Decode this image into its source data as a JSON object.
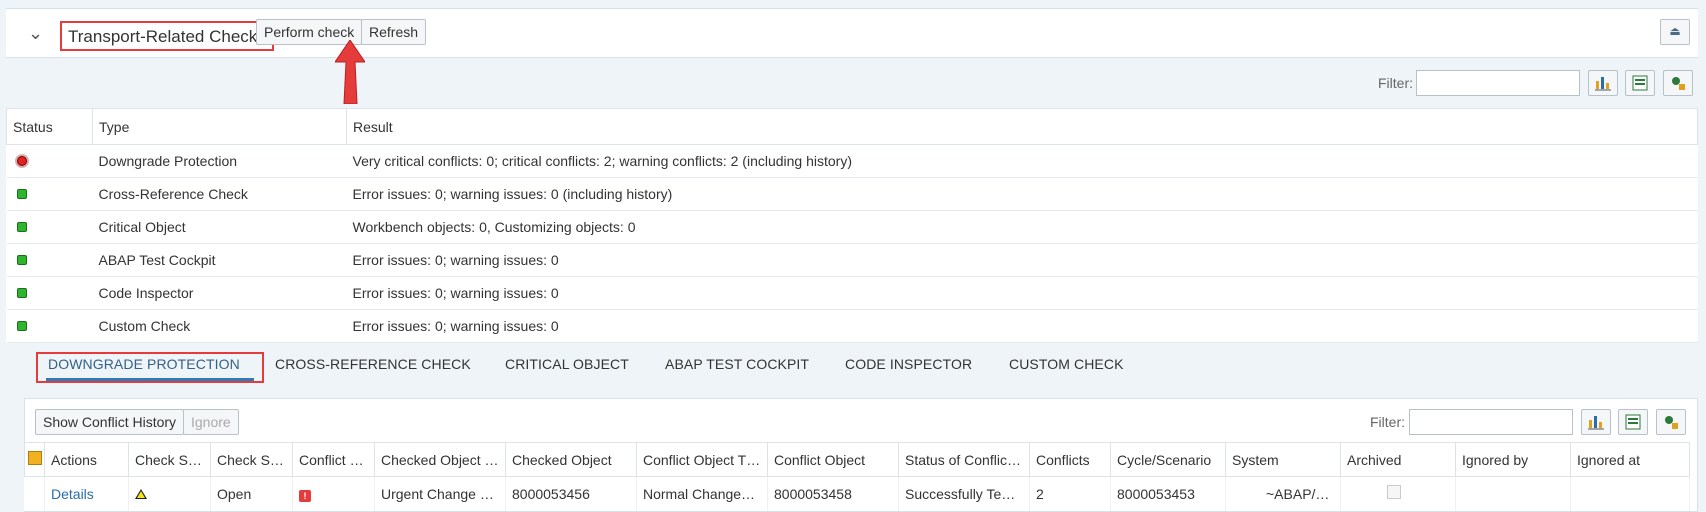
{
  "header": {
    "title": "Transport-Related Checks",
    "perform_check": "Perform check",
    "refresh": "Refresh"
  },
  "filter": {
    "label": "Filter:"
  },
  "checks": {
    "columns": [
      "Status",
      "Type",
      "Result"
    ],
    "rows": [
      {
        "status": "red",
        "type": "Downgrade Protection",
        "result": "Very critical conflicts: 0; critical conflicts: 2; warning conflicts: 2 (including history)"
      },
      {
        "status": "green",
        "type": "Cross-Reference Check",
        "result": "Error issues: 0; warning issues: 0 (including history)"
      },
      {
        "status": "green",
        "type": "Critical Object",
        "result": "Workbench objects: 0, Customizing objects: 0"
      },
      {
        "status": "green",
        "type": "ABAP Test Cockpit",
        "result": "Error issues: 0; warning issues: 0"
      },
      {
        "status": "green",
        "type": "Code Inspector",
        "result": "Error issues: 0; warning issues: 0"
      },
      {
        "status": "green",
        "type": "Custom Check",
        "result": "Error issues: 0; warning issues: 0"
      }
    ]
  },
  "tabs": [
    {
      "label": "DOWNGRADE PROTECTION",
      "active": true
    },
    {
      "label": "CROSS-REFERENCE CHECK"
    },
    {
      "label": "CRITICAL OBJECT"
    },
    {
      "label": "ABAP TEST COCKPIT"
    },
    {
      "label": "CODE INSPECTOR"
    },
    {
      "label": "CUSTOM CHECK"
    }
  ],
  "toolbar2": {
    "show_conflict_history": "Show Conflict History",
    "ignore": "Ignore"
  },
  "grid": {
    "columns": [
      "Actions",
      "Check S…",
      "Check S…",
      "Conflict …",
      "Checked Object …",
      "Checked Object",
      "Conflict Object T…",
      "Conflict Object",
      "Status of Conflic…",
      "Conflicts",
      "Cycle/Scenario",
      "System",
      "Archived",
      "Ignored by",
      "Ignored at"
    ],
    "row": {
      "actions": "Details",
      "check_status_2": "Open",
      "checked_object_type": "Urgent Change …",
      "checked_object": "8000053456",
      "conflict_object_type": "Normal Change…",
      "conflict_object": "8000053458",
      "status_of_conflict": "Successfully Te…",
      "conflicts": "2",
      "cycle": "8000053453",
      "system": "~ABAP/…",
      "ignored_by": "",
      "ignored_at": ""
    }
  }
}
